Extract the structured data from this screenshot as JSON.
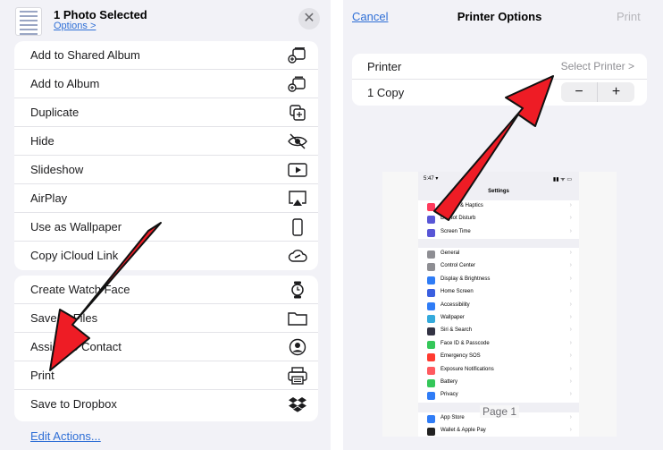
{
  "share_sheet": {
    "title": "1 Photo Selected",
    "options_link": "Options >",
    "close_symbol": "✕",
    "group1": [
      {
        "label": "Add to Shared Album",
        "icon": "shared-album-icon"
      },
      {
        "label": "Add to Album",
        "icon": "add-album-icon"
      },
      {
        "label": "Duplicate",
        "icon": "duplicate-icon"
      },
      {
        "label": "Hide",
        "icon": "hide-eye-icon"
      },
      {
        "label": "Slideshow",
        "icon": "slideshow-play-icon"
      },
      {
        "label": "AirPlay",
        "icon": "airplay-icon"
      },
      {
        "label": "Use as Wallpaper",
        "icon": "phone-icon"
      },
      {
        "label": "Copy iCloud Link",
        "icon": "cloud-link-icon"
      }
    ],
    "group2": [
      {
        "label": "Create Watch Face",
        "icon": "watch-icon"
      },
      {
        "label": "Save to Files",
        "icon": "folder-icon"
      },
      {
        "label": "Assign to Contact",
        "icon": "contact-icon"
      },
      {
        "label": "Print",
        "icon": "printer-icon"
      },
      {
        "label": "Save to Dropbox",
        "icon": "dropbox-icon"
      }
    ],
    "edit_actions": "Edit Actions..."
  },
  "printer_options": {
    "cancel": "Cancel",
    "title": "Printer Options",
    "print": "Print",
    "printer_label": "Printer",
    "printer_value": "Select Printer >",
    "copies_label": "1 Copy",
    "minus": "−",
    "plus": "+",
    "page_label": "Page 1"
  },
  "preview": {
    "status_time": "5:47 ▾",
    "status_right": "▮▮ ᯤ ▭",
    "heading": "Settings",
    "group_a": [
      {
        "label": "Sounds & Haptics",
        "color": "#ff3b5c"
      },
      {
        "label": "Do Not Disturb",
        "color": "#5856d6"
      },
      {
        "label": "Screen Time",
        "color": "#5856d6"
      }
    ],
    "group_b": [
      {
        "label": "General",
        "color": "#8e8e93"
      },
      {
        "label": "Control Center",
        "color": "#8e8e93"
      },
      {
        "label": "Display & Brightness",
        "color": "#2f7cf6"
      },
      {
        "label": "Home Screen",
        "color": "#3a5fe0"
      },
      {
        "label": "Accessibility",
        "color": "#2f7cf6"
      },
      {
        "label": "Wallpaper",
        "color": "#34aadc"
      },
      {
        "label": "Siri & Search",
        "color": "#333344"
      },
      {
        "label": "Face ID & Passcode",
        "color": "#34c759"
      },
      {
        "label": "Emergency SOS",
        "color": "#ff3b30"
      },
      {
        "label": "Exposure Notifications",
        "color": "#ff5a5f"
      },
      {
        "label": "Battery",
        "color": "#34c759"
      },
      {
        "label": "Privacy",
        "color": "#2f7cf6"
      }
    ],
    "group_c": [
      {
        "label": "App Store",
        "color": "#2f7cf6"
      },
      {
        "label": "Wallet & Apple Pay",
        "color": "#222222"
      }
    ]
  },
  "colors": {
    "accent_blue": "#2f6fd6",
    "arrow_red": "#ee1c25"
  }
}
